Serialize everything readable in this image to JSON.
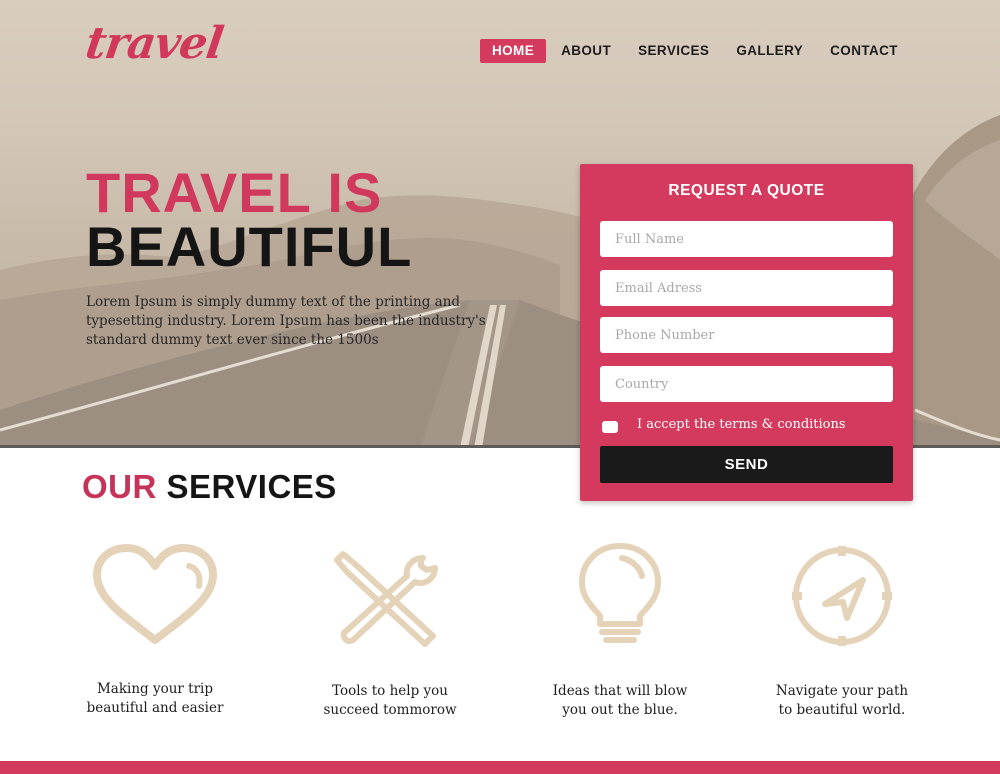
{
  "brand": {
    "logo": "travel",
    "accent": "#d43a5e",
    "icon_color": "#e4d3b8"
  },
  "nav": {
    "items": [
      {
        "label": "HOME",
        "active": true
      },
      {
        "label": "ABOUT",
        "active": false
      },
      {
        "label": "SERVICES",
        "active": false
      },
      {
        "label": "GALLERY",
        "active": false
      },
      {
        "label": "CONTACT",
        "active": false
      }
    ]
  },
  "hero": {
    "title_line1": "TRAVEL IS",
    "title_line2": "BEAUTIFUL",
    "text": "Lorem Ipsum is simply dummy text of the printing and typesetting industry. Lorem Ipsum has been the industry's standard dummy text ever since the 1500s"
  },
  "quote": {
    "title": "REQUEST A QUOTE",
    "fields": {
      "full_name": "Full Name",
      "email": "Email Adress",
      "phone": "Phone Number",
      "country": "Country"
    },
    "terms": "I accept the terms & conditions",
    "send": "SEND"
  },
  "services": {
    "title_accent": "OUR",
    "title_rest": "SERVICES",
    "items": [
      {
        "icon": "heart-icon",
        "line1": "Making your trip",
        "line2": "beautiful and easier"
      },
      {
        "icon": "tools-icon",
        "line1": "Tools to help you",
        "line2": "succeed tommorow"
      },
      {
        "icon": "lightbulb-icon",
        "line1": "Ideas that will blow",
        "line2": "you out the blue."
      },
      {
        "icon": "compass-icon",
        "line1": "Navigate your path",
        "line2": "to beautiful world."
      }
    ]
  }
}
